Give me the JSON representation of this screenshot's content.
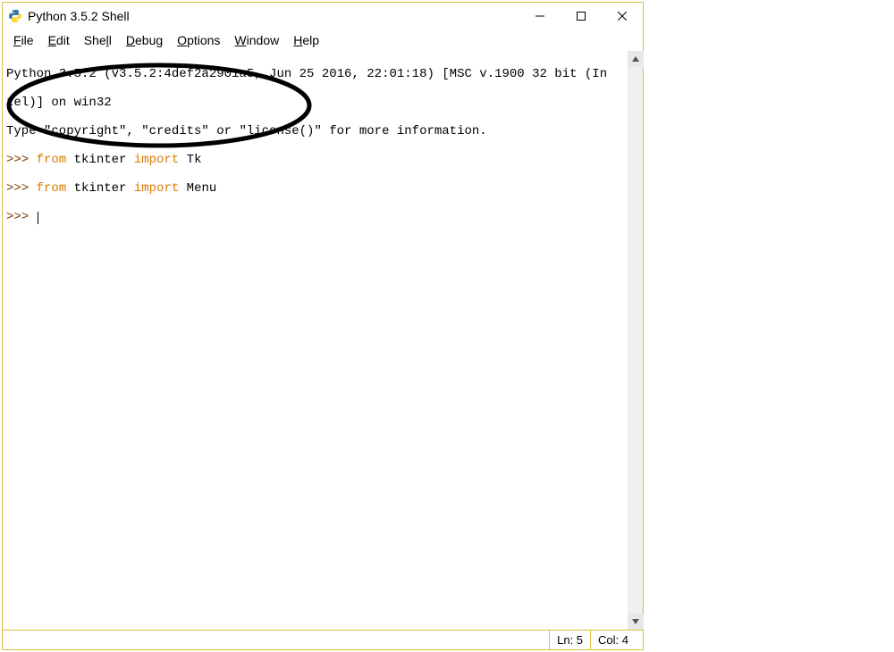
{
  "titlebar": {
    "title": "Python 3.5.2 Shell"
  },
  "menubar": {
    "items": [
      {
        "prefix": "",
        "ul": "F",
        "rest": "ile"
      },
      {
        "prefix": "",
        "ul": "E",
        "rest": "dit"
      },
      {
        "prefix": "She",
        "ul": "l",
        "rest": "l"
      },
      {
        "prefix": "",
        "ul": "D",
        "rest": "ebug"
      },
      {
        "prefix": "",
        "ul": "O",
        "rest": "ptions"
      },
      {
        "prefix": "",
        "ul": "W",
        "rest": "indow"
      },
      {
        "prefix": "",
        "ul": "H",
        "rest": "elp"
      }
    ]
  },
  "content": {
    "banner1": "Python 3.5.2 (v3.5.2:4def2a2901a5, Jun 25 2016, 22:01:18) [MSC v.1900 32 bit (In",
    "banner2": "tel)] on win32",
    "banner3": "Type \"copyright\", \"credits\" or \"license()\" for more information.",
    "prompt": ">>> ",
    "line1_kw1": "from",
    "line1_txt1": " tkinter ",
    "line1_kw2": "import",
    "line1_txt2": " Tk",
    "line2_kw1": "from",
    "line2_txt1": " tkinter ",
    "line2_kw2": "import",
    "line2_txt2": " Menu"
  },
  "statusbar": {
    "ln_label": "Ln: 5",
    "col_label": "Col: 4"
  }
}
